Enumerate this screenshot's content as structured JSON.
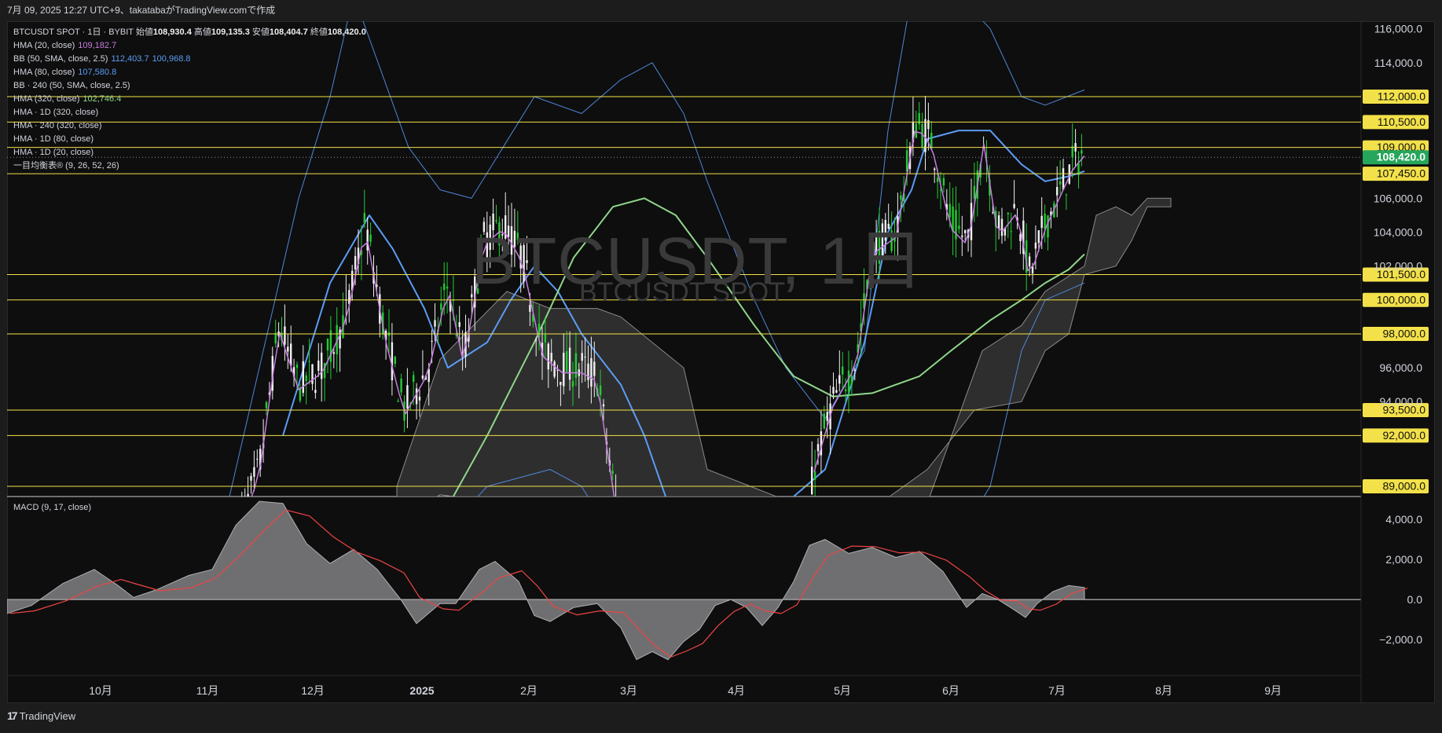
{
  "header": {
    "timestamp_line": "7月 09, 2025 12:27 UTC+9、takatabaがTradingView.comで作成"
  },
  "legend": {
    "symbol_line": {
      "symbol": "BTCUSDT SPOT · 1日 · BYBIT",
      "open_label": "始値",
      "open": "108,930.4",
      "high_label": "高値",
      "high": "109,135.3",
      "low_label": "安値",
      "low": "108,404.7",
      "close_label": "終値",
      "close": "108,420.0"
    },
    "indicators": [
      {
        "name": "HMA (20, close)",
        "value": "109,182.7",
        "color": "#c77ce0"
      },
      {
        "name": "BB (50, SMA, close, 2.5)",
        "value": "112,403.7",
        "value2": "100,968.8",
        "color": "#5b9cf5"
      },
      {
        "name": "HMA (80, close)",
        "value": "107,580.8",
        "color": "#5b9cf5"
      },
      {
        "name": "BB · 240 (50, SMA, close, 2.5)",
        "value": "",
        "color": "#5b9cf5"
      },
      {
        "name": "HMA (320, close)",
        "value": "102,746.4",
        "color": "#8fd68a"
      },
      {
        "name": "HMA · 1D (320, close)",
        "value": "",
        "color": ""
      },
      {
        "name": "HMA · 240 (320, close)",
        "value": "",
        "color": ""
      },
      {
        "name": "HMA · 1D (80, close)",
        "value": "",
        "color": ""
      },
      {
        "name": "HMA · 1D (20, close)",
        "value": "",
        "color": ""
      },
      {
        "name": "一目均衡表® (9, 26, 52, 26)",
        "value": "",
        "color": ""
      }
    ]
  },
  "watermark": {
    "main": "BTCUSDT, 1日",
    "sub": "BTCUSDT SPOT"
  },
  "price_axis": {
    "ticks": [
      "116,000.0",
      "114,000.0",
      "106,000.0",
      "104,000.0",
      "102,000.0",
      "96,000.0",
      "94,000.0"
    ],
    "levels": [
      {
        "label": "112,000.0",
        "value": 112000
      },
      {
        "label": "110,500.0",
        "value": 110500
      },
      {
        "label": "109,000.0",
        "value": 109000
      },
      {
        "label": "107,450.0",
        "value": 107450
      },
      {
        "label": "101,500.0",
        "value": 101500
      },
      {
        "label": "100,000.0",
        "value": 100000
      },
      {
        "label": "98,000.0",
        "value": 98000
      },
      {
        "label": "93,500.0",
        "value": 93500
      },
      {
        "label": "92,000.0",
        "value": 92000
      },
      {
        "label": "89,000.0",
        "value": 89000
      }
    ],
    "current": {
      "label": "108,420.0",
      "value": 108420,
      "color": "#26a65b"
    },
    "level_color": "#f3e14a"
  },
  "macd": {
    "label": "MACD (9, 17, close)",
    "ticks": [
      "4,000.0",
      "2,000.0",
      "0.0",
      "−2,000.0"
    ]
  },
  "time_axis": {
    "labels": [
      "10月",
      "11月",
      "12月",
      "2025",
      "2月",
      "3月",
      "4月",
      "5月",
      "6月",
      "7月",
      "8月",
      "9月"
    ]
  },
  "footer": {
    "brand": "TradingView",
    "logo_glyph": "17"
  }
}
